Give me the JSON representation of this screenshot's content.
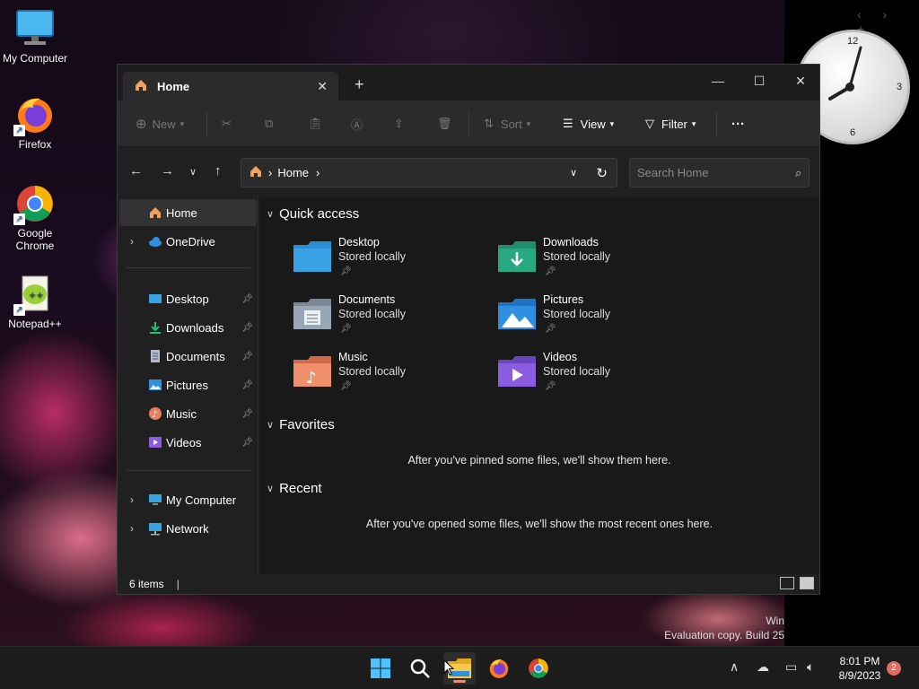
{
  "desktop": {
    "icons": [
      {
        "label": "My Computer"
      },
      {
        "label": "Firefox"
      },
      {
        "label": "Google Chrome"
      },
      {
        "label": "Notepad++"
      }
    ],
    "clock_numbers": {
      "twelve": "12",
      "three": "3",
      "six": "6"
    },
    "watermark": {
      "line1": "Win",
      "line2": "Evaluation copy. Build 25"
    }
  },
  "window": {
    "tab_title": "Home",
    "new_tab": "+",
    "controls": {
      "minimize": "—",
      "maximize": "☐",
      "close": "✕"
    },
    "toolbar": {
      "new_label": "New",
      "sort_label": "Sort",
      "view_label": "View",
      "filter_label": "Filter",
      "more_label": "···"
    },
    "address": {
      "segment": "Home"
    },
    "search": {
      "placeholder": "Search Home"
    },
    "sidebar": {
      "items": [
        {
          "label": "Home"
        },
        {
          "label": "OneDrive"
        },
        {
          "label": "Desktop"
        },
        {
          "label": "Downloads"
        },
        {
          "label": "Documents"
        },
        {
          "label": "Pictures"
        },
        {
          "label": "Music"
        },
        {
          "label": "Videos"
        },
        {
          "label": "My Computer"
        },
        {
          "label": "Network"
        }
      ]
    },
    "sections": {
      "quick_access": "Quick access",
      "favorites": "Favorites",
      "recent": "Recent"
    },
    "quick_access_items": [
      {
        "name": "Desktop",
        "sub": "Stored locally"
      },
      {
        "name": "Downloads",
        "sub": "Stored locally"
      },
      {
        "name": "Documents",
        "sub": "Stored locally"
      },
      {
        "name": "Pictures",
        "sub": "Stored locally"
      },
      {
        "name": "Music",
        "sub": "Stored locally"
      },
      {
        "name": "Videos",
        "sub": "Stored locally"
      }
    ],
    "favorites_empty": "After you've pinned some files, we'll show them here.",
    "recent_empty": "After you've opened some files, we'll show the most recent ones here.",
    "status": {
      "items_count": "6 items"
    }
  },
  "taskbar": {
    "time": "8:01 PM",
    "date": "8/9/2023",
    "notification_count": "2"
  },
  "colors": {
    "accent": "#e88e74",
    "window_bg": "#202020",
    "folder_blue": "#3aa3e6",
    "folder_green": "#27a982"
  }
}
